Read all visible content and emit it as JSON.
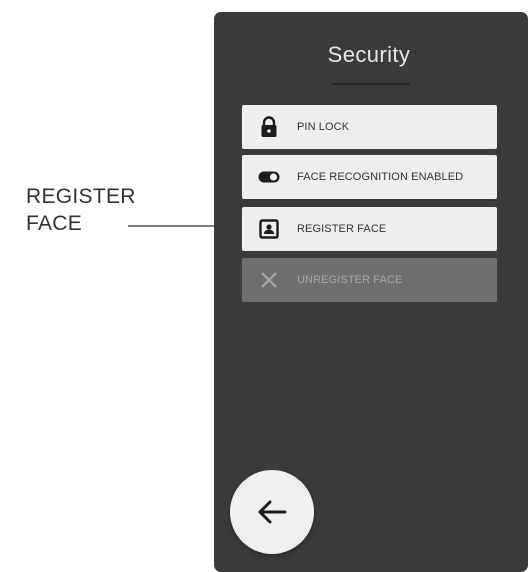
{
  "callout": {
    "line1": "REGISTER",
    "line2": "FACE"
  },
  "header": {
    "title": "Security"
  },
  "menu": {
    "items": [
      {
        "label": "PIN LOCK",
        "icon": "lock-icon",
        "enabled": true
      },
      {
        "label": "FACE RECOGNITION ENABLED",
        "icon": "toggle-on-icon",
        "enabled": true
      },
      {
        "label": "REGISTER FACE",
        "icon": "user-portrait-icon",
        "enabled": true
      },
      {
        "label": "UNREGISTER FACE",
        "icon": "close-icon",
        "enabled": false
      }
    ]
  },
  "footer": {
    "back_icon": "arrow-left-icon"
  },
  "colors": {
    "panel_bg": "#3b3b3d",
    "item_bg": "#eeeeee",
    "item_disabled_bg": "#6f6f71",
    "title_text": "#e7e7e7"
  }
}
